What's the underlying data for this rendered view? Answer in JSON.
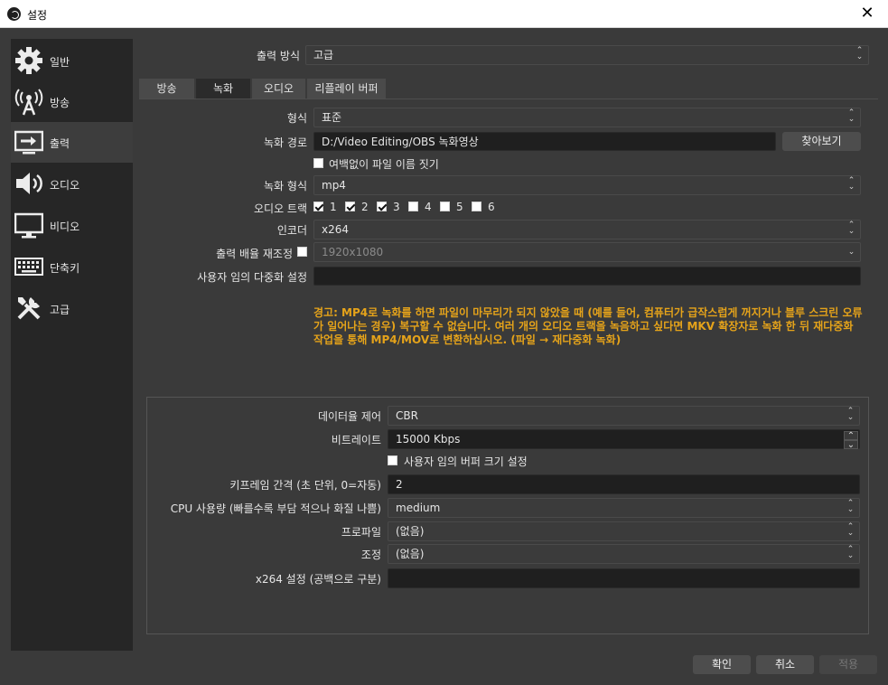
{
  "window": {
    "title": "설정",
    "close_glyph": "✕"
  },
  "sidebar": {
    "items": [
      {
        "label": "일반",
        "icon": "gear-icon"
      },
      {
        "label": "방송",
        "icon": "broadcast-icon"
      },
      {
        "label": "출력",
        "icon": "output-icon",
        "active": true
      },
      {
        "label": "오디오",
        "icon": "speaker-icon"
      },
      {
        "label": "비디오",
        "icon": "monitor-icon"
      },
      {
        "label": "단축키",
        "icon": "keyboard-icon"
      },
      {
        "label": "고급",
        "icon": "tools-icon"
      }
    ]
  },
  "output_mode": {
    "label": "출력 방식",
    "value": "고급"
  },
  "tabs": [
    {
      "label": "방송"
    },
    {
      "label": "녹화",
      "active": true
    },
    {
      "label": "오디오"
    },
    {
      "label": "리플레이 버퍼"
    }
  ],
  "recording": {
    "type": {
      "label": "형식",
      "value": "표준"
    },
    "path": {
      "label": "녹화 경로",
      "value": "D:/Video Editing/OBS 녹화영상",
      "browse": "찾아보기"
    },
    "no_space": {
      "label": "여백없이 파일 이름 짓기",
      "checked": false
    },
    "format": {
      "label": "녹화 형식",
      "value": "mp4"
    },
    "audio_track": {
      "label": "오디오 트랙",
      "tracks": [
        {
          "n": "1",
          "checked": true
        },
        {
          "n": "2",
          "checked": true
        },
        {
          "n": "3",
          "checked": true
        },
        {
          "n": "4",
          "checked": false
        },
        {
          "n": "5",
          "checked": false
        },
        {
          "n": "6",
          "checked": false
        }
      ]
    },
    "encoder": {
      "label": "인코더",
      "value": "x264"
    },
    "rescale": {
      "label": "출력 배율 재조정",
      "value": "1920x1080",
      "checked": false
    },
    "muxer": {
      "label": "사용자 임의 다중화 설정",
      "value": ""
    },
    "warning": "경고: MP4로 녹화를 하면 파일이 마무리가 되지 않았을 때 (예를 들어, 컴퓨터가 급작스럽게 꺼지거나 블루 스크린 오류가 일어나는 경우) 복구할 수 없습니다. 여러 개의 오디오 트랙을 녹음하고 싶다면 MKV 확장자로 녹화 한 뒤 재다중화 작업을 통해 MP4/MOV로 변환하십시오. (파일 → 재다중화 녹화)"
  },
  "encoder_settings": {
    "rate_control": {
      "label": "데이터율 제어",
      "value": "CBR"
    },
    "bitrate": {
      "label": "비트레이트",
      "value": "15000 Kbps"
    },
    "custom_buffer": {
      "label": "사용자 임의 버퍼 크기 설정",
      "checked": false
    },
    "keyframe": {
      "label": "키프레임 간격 (초 단위, 0=자동)",
      "value": "2"
    },
    "cpu_preset": {
      "label": "CPU 사용량 (빠를수록 부담 적으나 화질 나쁨)",
      "value": "medium"
    },
    "profile": {
      "label": "프로파일",
      "value": "(없음)"
    },
    "tune": {
      "label": "조정",
      "value": "(없음)"
    },
    "x264opts": {
      "label": "x264 설정 (공백으로 구분)",
      "value": ""
    }
  },
  "footer": {
    "ok": "확인",
    "cancel": "취소",
    "apply": "적용"
  }
}
